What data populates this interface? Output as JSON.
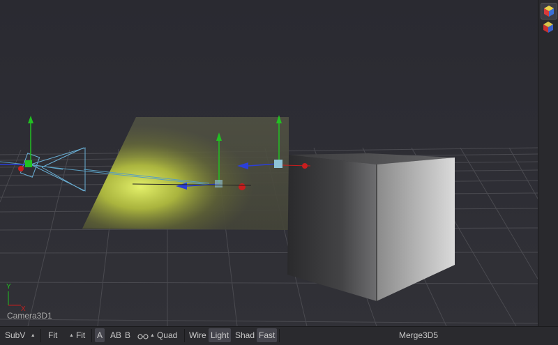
{
  "viewport": {
    "view_name": "Camera3D1",
    "axis_y": "Y",
    "axis_x": "X"
  },
  "sidebar": {
    "buttons": [
      {
        "name": "3d-view-icon",
        "active": true
      },
      {
        "name": "3d-view-alt-icon",
        "active": false
      }
    ]
  },
  "toolbar": {
    "subview": "SubV",
    "fit1": "Fit",
    "fit2": "Fit",
    "a": "A",
    "ab": "AB",
    "b": "B",
    "quad": "Quad",
    "wire": "Wire",
    "light": "Light",
    "shad": "Shad",
    "fast": "Fast",
    "node_name": "Merge3D5"
  },
  "colors": {
    "accent_yellow": "#d8e45a",
    "axis_green": "#22c022",
    "axis_blue": "#2b3fd8",
    "axis_red": "#c81e1e",
    "camera_cyan": "#6ab0d6"
  }
}
